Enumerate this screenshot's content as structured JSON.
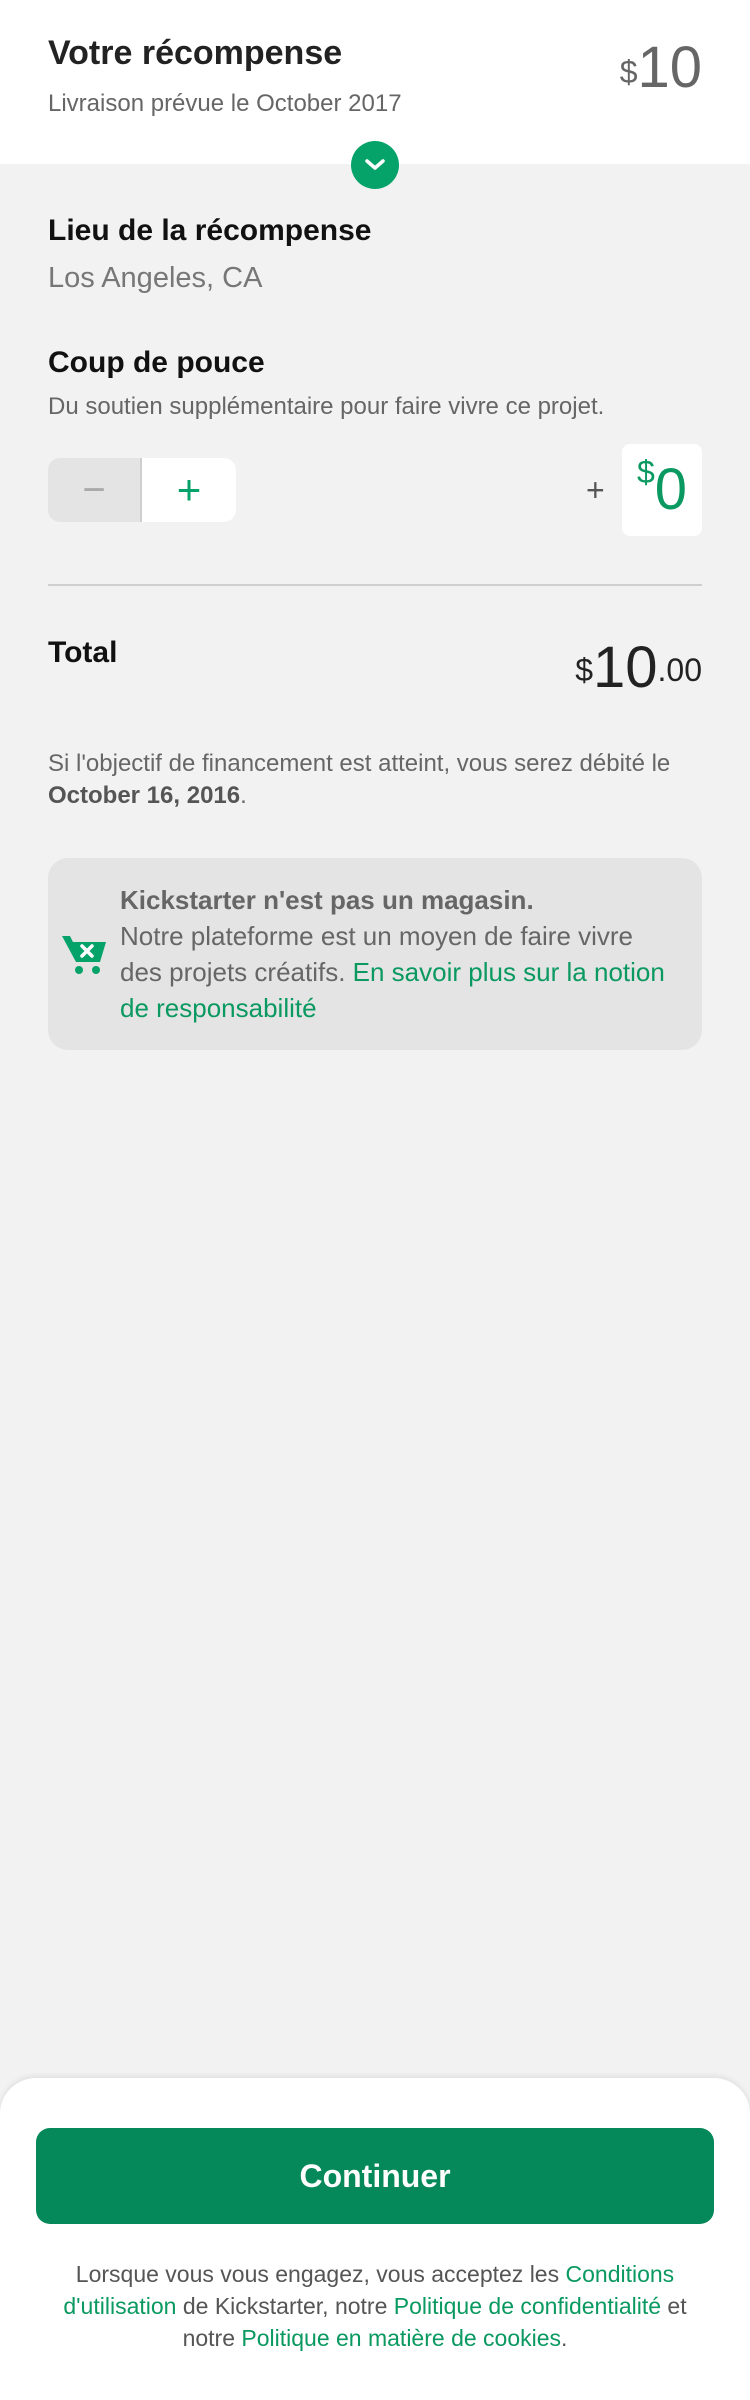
{
  "header": {
    "title": "Votre récompense",
    "subtitle": "Livraison prévue le October 2017",
    "currency": "$",
    "amount": "10"
  },
  "location": {
    "title": "Lieu de la récompense",
    "value": "Los Angeles, CA"
  },
  "boost": {
    "title": "Coup de pouce",
    "description": "Du soutien supplémentaire pour faire vivre ce projet.",
    "minus_label": "−",
    "plus_label": "+",
    "prefix_sign": "+",
    "currency": "$",
    "amount": "0"
  },
  "total": {
    "label": "Total",
    "currency": "$",
    "amount": "10",
    "cents": ".00"
  },
  "charge_note": {
    "text": "Si l'objectif de financement est atteint, vous serez débité le ",
    "date": "October 16, 2016",
    "end": "."
  },
  "notice": {
    "title": "Kickstarter n'est pas un magasin.",
    "body": "Notre plateforme est un moyen de faire vivre des projets créatifs. ",
    "link": "En savoir plus sur la notion de responsabilité",
    "icon": "cart-x-icon"
  },
  "footer": {
    "continue_label": "Continuer",
    "legal_1": "Lorsque vous vous engagez, vous acceptez les ",
    "terms_link": "Conditions d'utilisation",
    "legal_2": " de Kickstarter, notre ",
    "privacy_link": "Politique de confidentialité",
    "legal_3": " et notre ",
    "cookie_link": "Politique en matière de cookies",
    "legal_4": "."
  },
  "colors": {
    "accent": "#05a36a",
    "button": "#05885a"
  }
}
